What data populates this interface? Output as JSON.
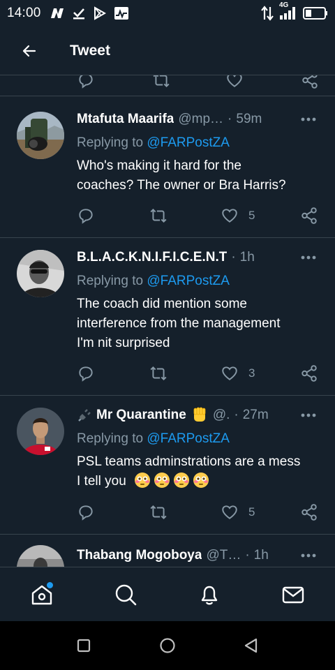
{
  "status_bar": {
    "time": "14:00",
    "network": "4G"
  },
  "header": {
    "title": "Tweet"
  },
  "tweets": [
    {
      "name": "Mtafuta Maarifa",
      "handle": "@mp…",
      "time": "59m",
      "replying_label": "Replying to",
      "replying_to": "@FARPostZA",
      "text_lines": [
        "Who's making it hard for the",
        "coaches? The owner or Bra Harris?"
      ],
      "likes": "5"
    },
    {
      "name": "B.L.A.C.K.N.I.F.I.C.E.N.T",
      "handle": "",
      "time": "1h",
      "replying_label": "Replying to",
      "replying_to": "@FARPostZA",
      "text_lines": [
        "The coach did mention some",
        "interference from the management",
        "I'm nit surprised"
      ],
      "likes": "3"
    },
    {
      "name": "Mr Quarantine",
      "handle": "@.",
      "time": "27m",
      "replying_label": "Replying to",
      "replying_to": "@FARPostZA",
      "text_lines": [
        "PSL teams adminstrations are a mess",
        "I tell you"
      ],
      "likes": "5"
    },
    {
      "name": "Thabang Mogoboya",
      "handle": "@T…",
      "time": "1h"
    }
  ],
  "separator": "·",
  "colors": {
    "background": "#15202b",
    "accent": "#1d9bf0",
    "secondary_text": "#8899a6",
    "divider": "#38444d"
  },
  "icons": {
    "back": "arrow-left-icon",
    "more": "more-horizontal-icon",
    "reply": "reply-icon",
    "retweet": "retweet-icon",
    "like": "heart-icon",
    "share": "share-icon",
    "home": "home-icon",
    "search": "search-icon",
    "notifications": "bell-icon",
    "messages": "mail-icon"
  }
}
